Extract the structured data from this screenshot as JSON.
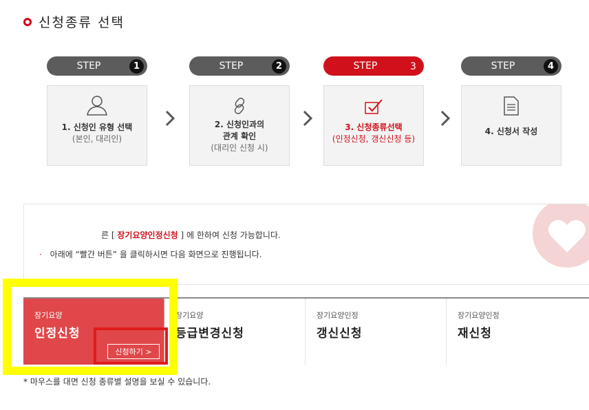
{
  "section_title": "신청종류 선택",
  "steps": [
    {
      "word": "STEP",
      "num": "1",
      "main": "1. 신청인 유형 선택",
      "sub": "(본인, 대리인)",
      "icon": "person-icon"
    },
    {
      "word": "STEP",
      "num": "2",
      "main": "2. 신청인과의 관계 확인",
      "main_line1": "2. 신청인과의",
      "main_line2": "관계 확인",
      "sub": "(대리인 신청 시)",
      "icon": "link-icon"
    },
    {
      "word": "STEP",
      "num": "3",
      "main": "3. 신청종류선택",
      "sub": "(인정신청, 갱신신청 등)",
      "icon": "checkbox-icon"
    },
    {
      "word": "STEP",
      "num": "4",
      "main": "4. 신청서 작성",
      "sub": "",
      "icon": "document-icon"
    }
  ],
  "notice": {
    "line1_prefix": "른 [",
    "line1_highlight": "장기요양인정신청",
    "line1_suffix": "] 에 한하여 신청 가능합니다.",
    "line2": "아래에 “빨간 버튼” 을 클릭하시면 다음 화면으로 진행됩니다."
  },
  "tabs": [
    {
      "top": "장기요양",
      "main": "인정신청",
      "button": "신청하기 >"
    },
    {
      "top": "장기요양",
      "main": "등급변경신청"
    },
    {
      "top": "장기요양인정",
      "main": "갱신신청"
    },
    {
      "top": "장기요양인정",
      "main": "재신청"
    }
  ],
  "footnote": "* 마우스를 대면 신청 종류별 설명을 보실 수 있습니다.",
  "colors": {
    "accent": "#d0111b",
    "active_tab": "#e0474a",
    "highlight_yellow": "#ffff00",
    "highlight_red": "#e01b1b"
  }
}
